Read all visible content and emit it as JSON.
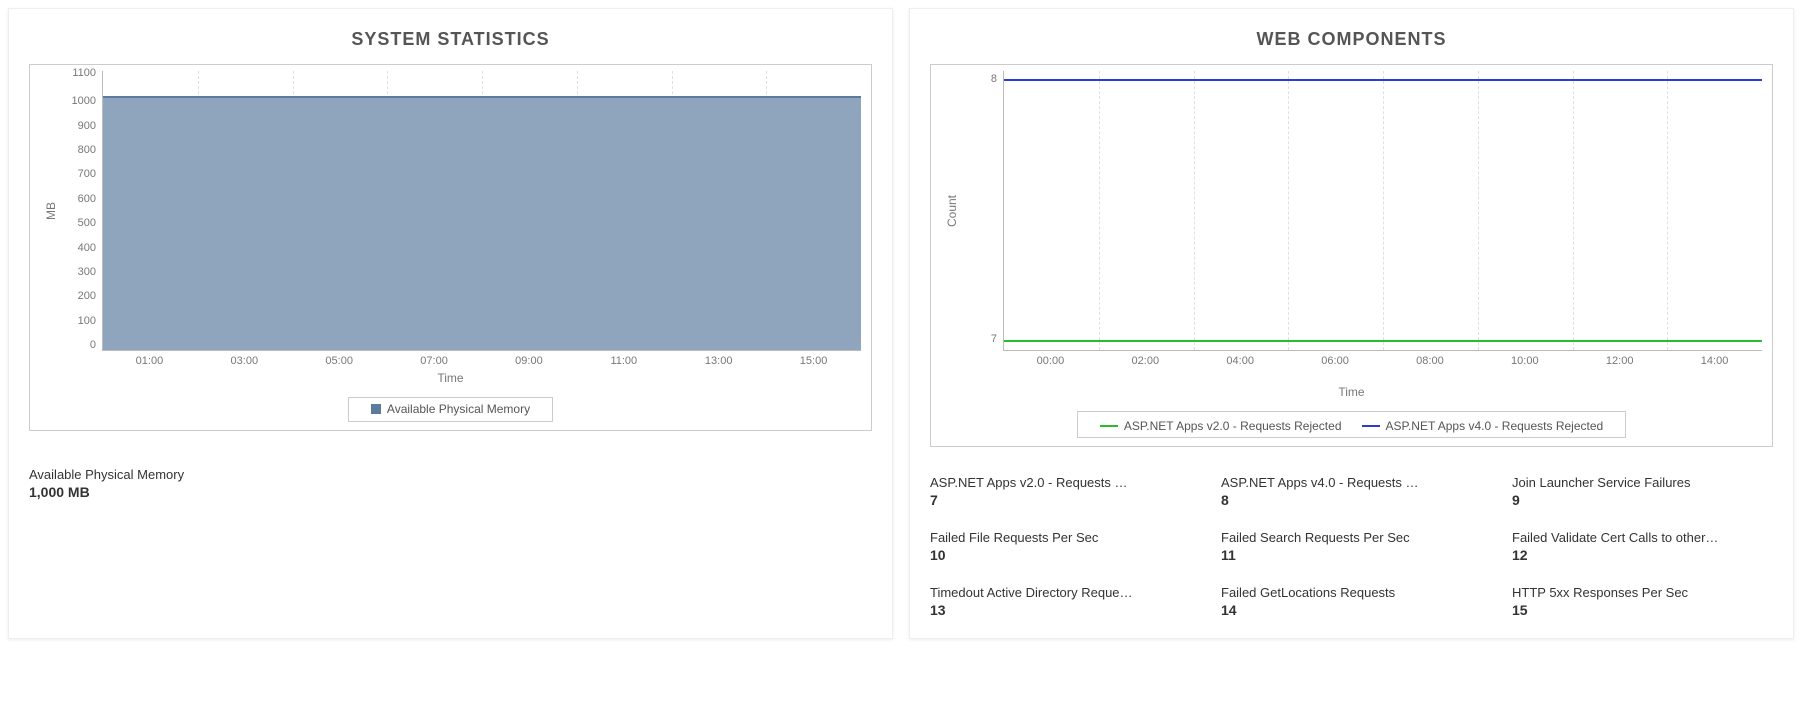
{
  "left_panel": {
    "title": "SYSTEM STATISTICS",
    "ylabel": "MB",
    "xlabel": "Time",
    "yticks": [
      "1100",
      "1000",
      "900",
      "800",
      "700",
      "600",
      "500",
      "400",
      "300",
      "200",
      "100",
      "0"
    ],
    "xticks": [
      "01:00",
      "03:00",
      "05:00",
      "07:00",
      "09:00",
      "11:00",
      "13:00",
      "15:00"
    ],
    "legend": [
      {
        "name": "Available Physical Memory",
        "color": "#5a7a9e",
        "fill": "#8fa5bd"
      }
    ],
    "stat": {
      "label": "Available Physical Memory",
      "value": "1,000 MB"
    }
  },
  "right_panel": {
    "title": "WEB COMPONENTS",
    "ylabel": "Count",
    "xlabel": "Time",
    "yticks": [
      "8",
      "7"
    ],
    "xticks": [
      "00:00",
      "02:00",
      "04:00",
      "06:00",
      "08:00",
      "10:00",
      "12:00",
      "14:00"
    ],
    "legend": [
      {
        "name": "ASP.NET Apps v2.0 - Requests Rejected",
        "color": "#2cbb2c"
      },
      {
        "name": "ASP.NET Apps v4.0 - Requests Rejected",
        "color": "#2b3bd6"
      }
    ],
    "metrics": [
      {
        "label": "ASP.NET Apps v2.0 - Requests …",
        "value": "7"
      },
      {
        "label": "ASP.NET Apps v4.0 - Requests …",
        "value": "8"
      },
      {
        "label": "Join Launcher Service Failures",
        "value": "9"
      },
      {
        "label": "Failed File Requests Per Sec",
        "value": "10"
      },
      {
        "label": "Failed Search Requests Per Sec",
        "value": "11"
      },
      {
        "label": "Failed Validate Cert Calls to other…",
        "value": "12"
      },
      {
        "label": "Timedout Active Directory Reque…",
        "value": "13"
      },
      {
        "label": "Failed GetLocations Requests",
        "value": "14"
      },
      {
        "label": "HTTP 5xx Responses Per Sec",
        "value": "15"
      }
    ]
  },
  "chart_data": [
    {
      "type": "area",
      "title": "SYSTEM STATISTICS",
      "xlabel": "Time",
      "ylabel": "MB",
      "ylim": [
        0,
        1100
      ],
      "x": [
        "00:00",
        "01:00",
        "02:00",
        "03:00",
        "04:00",
        "05:00",
        "06:00",
        "07:00",
        "08:00",
        "09:00",
        "10:00",
        "11:00",
        "12:00",
        "13:00",
        "14:00",
        "15:00"
      ],
      "series": [
        {
          "name": "Available Physical Memory",
          "values": [
            1000,
            1000,
            1000,
            1000,
            1000,
            1000,
            1000,
            1000,
            1000,
            1000,
            1000,
            1000,
            1000,
            1000,
            1000,
            1000
          ],
          "color": "#8fa5bd"
        }
      ],
      "legend_position": "bottom"
    },
    {
      "type": "line",
      "title": "WEB COMPONENTS",
      "xlabel": "Time",
      "ylabel": "Count",
      "ylim": [
        7,
        8
      ],
      "x": [
        "00:00",
        "01:00",
        "02:00",
        "03:00",
        "04:00",
        "05:00",
        "06:00",
        "07:00",
        "08:00",
        "09:00",
        "10:00",
        "11:00",
        "12:00",
        "13:00",
        "14:00",
        "15:00"
      ],
      "series": [
        {
          "name": "ASP.NET Apps v2.0 - Requests Rejected",
          "values": [
            7,
            7,
            7,
            7,
            7,
            7,
            7,
            7,
            7,
            7,
            7,
            7,
            7,
            7,
            7,
            7
          ],
          "color": "#2cbb2c"
        },
        {
          "name": "ASP.NET Apps v4.0 - Requests Rejected",
          "values": [
            8,
            8,
            8,
            8,
            8,
            8,
            8,
            8,
            8,
            8,
            8,
            8,
            8,
            8,
            8,
            8
          ],
          "color": "#2b3bd6"
        }
      ],
      "legend_position": "bottom"
    }
  ]
}
